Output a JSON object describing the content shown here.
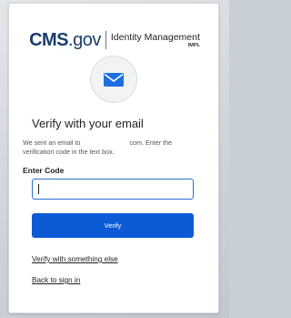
{
  "header": {
    "logo_main": "CMS",
    "logo_suffix": ".gov",
    "product_name": "Identity Management",
    "environment": "IMPL"
  },
  "verify": {
    "heading": "Verify with your email",
    "message_before": "We sent an email to",
    "message_after": "com. Enter the verification code in the text box.",
    "code_label": "Enter Code",
    "code_value": "",
    "verify_button": "Verify",
    "alt_link": "Verify with something else",
    "back_link": "Back to sign in"
  },
  "icons": {
    "mail": "mail-icon"
  },
  "colors": {
    "brand_navy": "#1b3d6d",
    "primary_button": "#0d5ad6",
    "input_focus": "#2c6fd1"
  }
}
